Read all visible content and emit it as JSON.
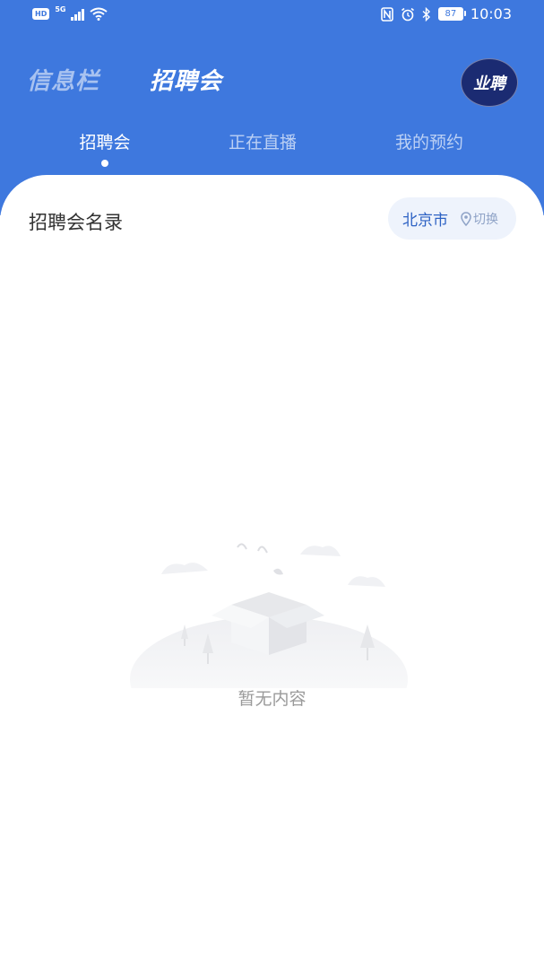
{
  "status_bar": {
    "hd": "HD",
    "network": "5G",
    "battery": "87",
    "time": "10:03"
  },
  "top_nav": {
    "items": [
      {
        "label": "信息栏",
        "active": false
      },
      {
        "label": "招聘会",
        "active": true
      }
    ]
  },
  "logo": {
    "text": "业聘"
  },
  "sub_tabs": [
    {
      "label": "招聘会",
      "active": true
    },
    {
      "label": "正在直播",
      "active": false
    },
    {
      "label": "我的预约",
      "active": false
    }
  ],
  "section": {
    "title": "招聘会名录",
    "city": "北京市",
    "switch_label": "切换"
  },
  "empty_state": {
    "text": "暂无内容"
  },
  "colors": {
    "primary": "#3e78de",
    "logo_bg": "#1b2b72",
    "pill_bg": "#eef3fc",
    "city_text": "#2d62c4"
  }
}
